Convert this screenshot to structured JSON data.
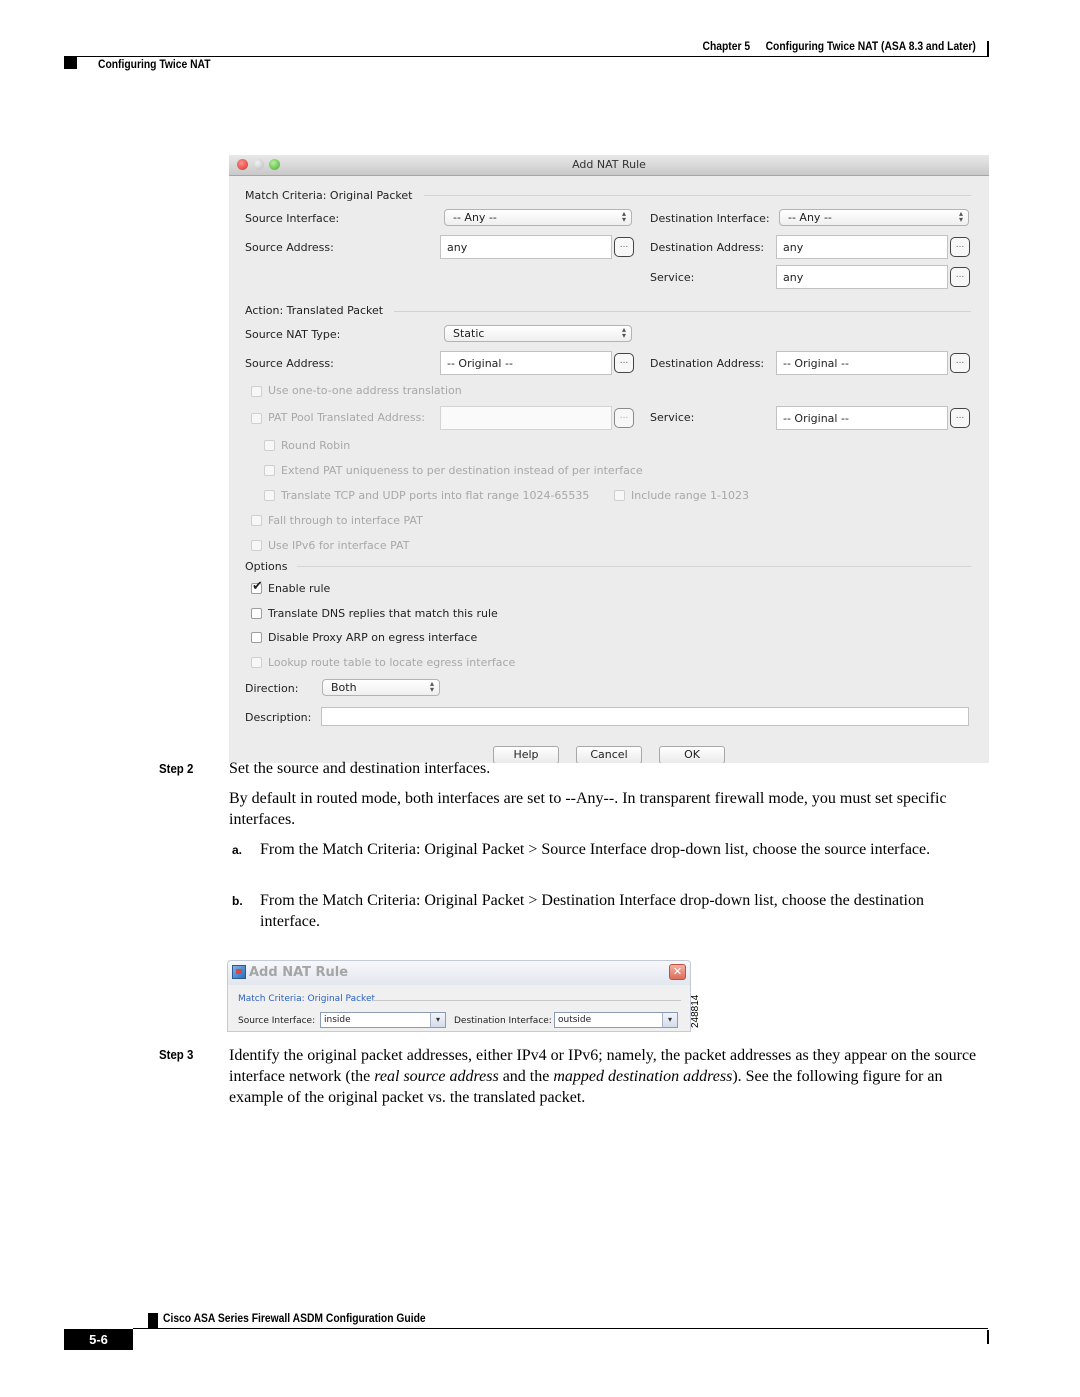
{
  "header": {
    "chapter_label": "Chapter 5",
    "chapter_title": "Configuring Twice NAT (ASA 8.3 and Later)",
    "section": "Configuring Twice NAT"
  },
  "mac_dialog": {
    "title": "Add NAT Rule",
    "match_criteria": {
      "title": "Match Criteria: Original Packet",
      "source_interface_label": "Source Interface:",
      "source_interface_value": "-- Any --",
      "destination_interface_label": "Destination Interface:",
      "destination_interface_value": "-- Any --",
      "source_address_label": "Source Address:",
      "source_address_value": "any",
      "destination_address_label": "Destination Address:",
      "destination_address_value": "any",
      "service_label": "Service:",
      "service_value": "any"
    },
    "action": {
      "title": "Action: Translated Packet",
      "source_nat_type_label": "Source NAT Type:",
      "source_nat_type_value": "Static",
      "source_address_label": "Source Address:",
      "source_address_value": "-- Original --",
      "destination_address_label": "Destination Address:",
      "destination_address_value": "-- Original --",
      "one_to_one_label": "Use one-to-one address translation",
      "pat_pool_label": "PAT Pool Translated Address:",
      "pat_pool_value": "",
      "service_label": "Service:",
      "service_value": "-- Original --",
      "round_robin_label": "Round Robin",
      "extend_pat_label": "Extend PAT uniqueness to per destination instead of per interface",
      "flat_range_label": "Translate TCP and UDP ports into flat range 1024-65535",
      "include_range_label": "Include range 1-1023",
      "fall_through_label": "Fall through to interface PAT",
      "ipv6_label": "Use IPv6 for interface PAT"
    },
    "options": {
      "title": "Options",
      "enable_rule_label": "Enable rule",
      "enable_rule_checked": true,
      "translate_dns_label": "Translate DNS replies that match this rule",
      "disable_proxy_arp_label": "Disable Proxy ARP on egress interface",
      "lookup_route_label": "Lookup route table to locate egress interface",
      "direction_label": "Direction:",
      "direction_value": "Both",
      "description_label": "Description:",
      "description_value": ""
    },
    "buttons": {
      "help": "Help",
      "cancel": "Cancel",
      "ok": "OK",
      "browse": "..."
    }
  },
  "step2": {
    "label": "Step 2",
    "text": "Set the source and destination interfaces.",
    "para": "By default in routed mode, both interfaces are set to --Any--. In transparent firewall mode, you must set specific interfaces.",
    "items": [
      {
        "marker": "a.",
        "text": "From the Match Criteria: Original Packet > Source Interface drop-down list, choose the source interface."
      },
      {
        "marker": "b.",
        "text": "From the Match Criteria: Original Packet > Destination Interface drop-down list, choose the destination interface."
      }
    ]
  },
  "win_dialog": {
    "title": "Add NAT Rule",
    "section": "Match Criteria: Original Packet",
    "source_interface_label": "Source Interface:",
    "source_interface_value": "inside",
    "destination_interface_label": "Destination Interface:",
    "destination_interface_value": "outside",
    "figure_id": "248814"
  },
  "step3": {
    "label": "Step 3",
    "text_before": "Identify the original packet addresses, either IPv4 or IPv6; namely, the packet addresses as they appear on the source interface network (the ",
    "em1": "real source address",
    "text_mid": " and the ",
    "em2": "mapped destination address",
    "text_after": "). See the following figure for an example of the original packet vs. the translated packet."
  },
  "footer": {
    "guide_title": "Cisco ASA Series Firewall ASDM Configuration Guide",
    "page_number": "5-6"
  }
}
